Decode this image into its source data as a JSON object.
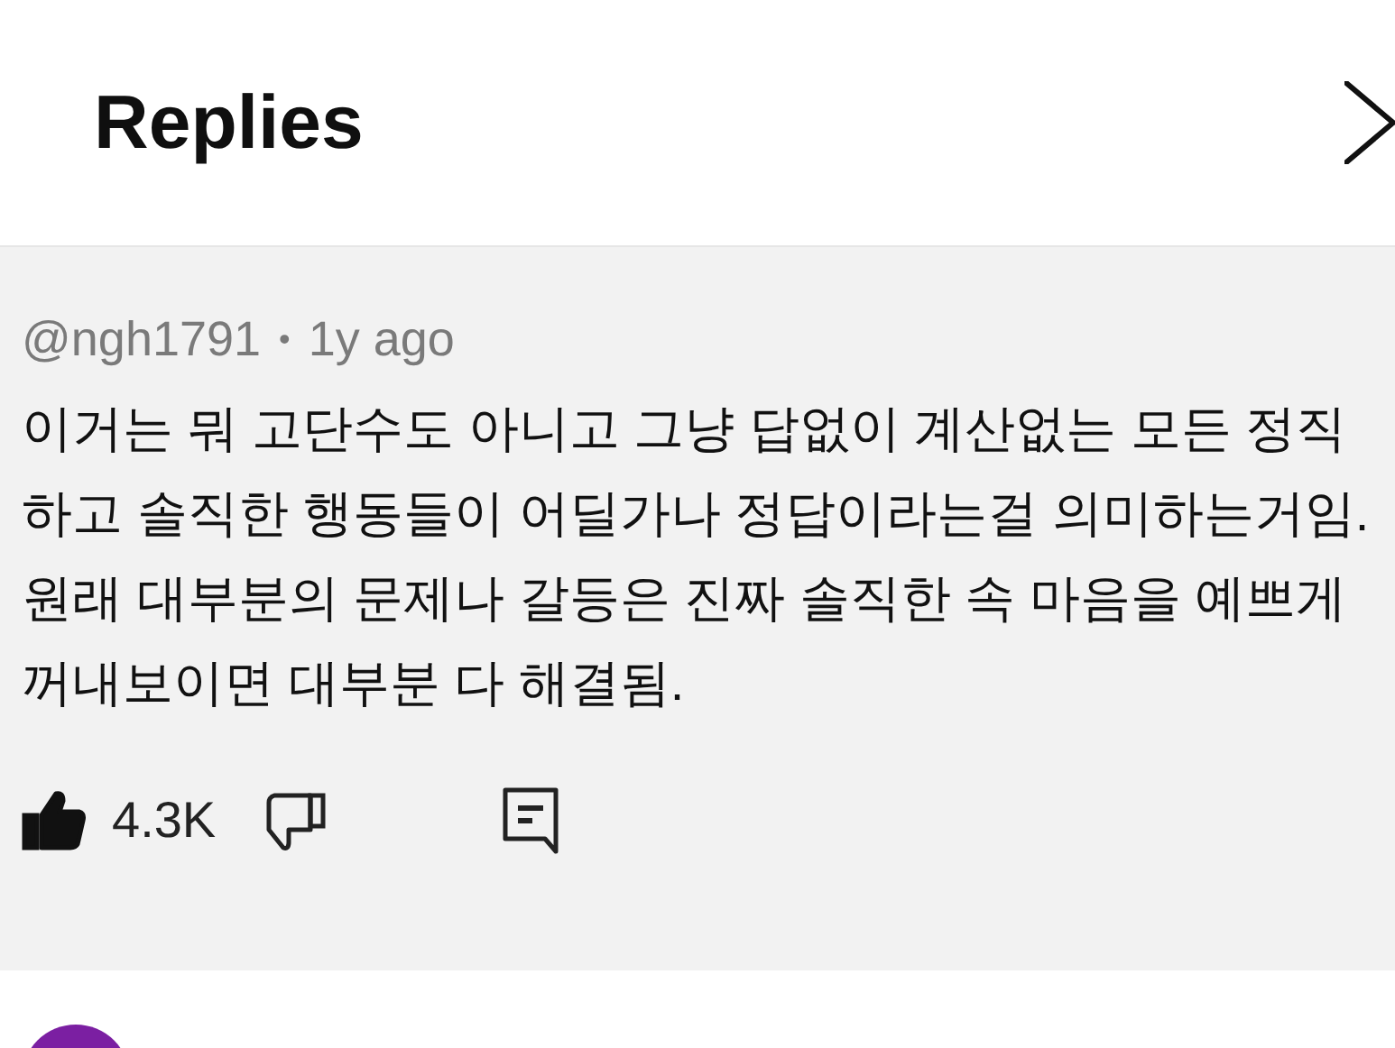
{
  "header": {
    "title": "Replies"
  },
  "comment": {
    "author": "@ngh1791",
    "separator": "•",
    "time": "1y ago",
    "text": "이거는 뭐 고단수도 아니고 그냥 답없이 계산없는 모든 정직하고 솔직한 행동들이 어딜가나 정답이라는걸 의미하는거임. 원래 대부분의 문제나 갈등은 진짜 솔직한 속 마음을 예쁘게 꺼내보이면 대부분 다 해결됨.",
    "likes": "4.3K",
    "liked": true,
    "disliked": false
  },
  "next_reply": {
    "color": "#7b1fa2"
  }
}
